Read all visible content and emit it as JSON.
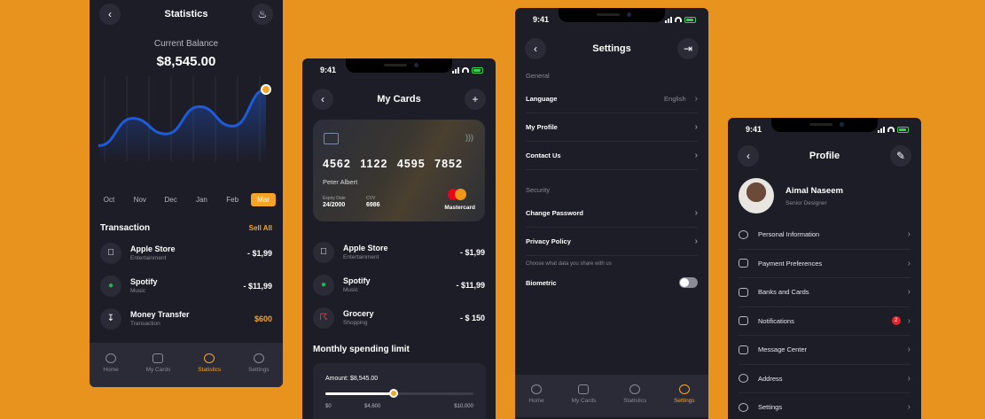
{
  "colors": {
    "background": "#E8931D",
    "panel": "#1D1D27",
    "accent": "#F7A325",
    "muted": "#8A8A97"
  },
  "statistics_screen": {
    "title": "Statistics",
    "balance_label": "Current Balance",
    "balance_value": "$8,545.00",
    "months": [
      "Oct",
      "Nov",
      "Dec",
      "Jan",
      "Feb",
      "Mar"
    ],
    "active_month": "Mar",
    "transaction_title": "Transaction",
    "see_all": "Sell All",
    "transactions": [
      {
        "icon": "apple-icon",
        "name": "Apple Store",
        "category": "Entertainment",
        "amount": "- $1,99"
      },
      {
        "icon": "spotify-icon",
        "name": "Spotify",
        "category": "Music",
        "amount": "- $11,99"
      },
      {
        "icon": "download-icon",
        "name": "Money Transfer",
        "category": "Transaction",
        "amount": "$600"
      }
    ]
  },
  "cards_screen": {
    "time": "9:41",
    "title": "My Cards",
    "card": {
      "number": "4562 1122 4595 7852",
      "holder": "Peter Albert",
      "expiry_label": "Expiry Date",
      "expiry": "24/2000",
      "cvv_label": "CVV",
      "cvv": "6986",
      "brand": "Mastercard"
    },
    "transactions": [
      {
        "icon": "apple-icon",
        "name": "Apple Store",
        "category": "Entertainment",
        "amount": "- $1,99"
      },
      {
        "icon": "spotify-icon",
        "name": "Spotify",
        "category": "Music",
        "amount": "- $11,99"
      },
      {
        "icon": "cart-icon",
        "name": "Grocery",
        "category": "Shopping",
        "amount": "- $ 150"
      }
    ],
    "limit_title": "Monthly spending limit",
    "limit_amount": "Amount: $8,545.00",
    "slider_fraction": 0.46,
    "scale": [
      "$0",
      "$4,600",
      "$10,000"
    ]
  },
  "settings_screen": {
    "time": "9:41",
    "title": "Settings",
    "general_label": "General",
    "language_label": "Language",
    "language_value": "English",
    "my_profile": "My Profile",
    "contact_us": "Contact Us",
    "security_label": "Security",
    "change_password": "Change Password",
    "privacy_policy": "Privacy Policy",
    "privacy_note": "Choose what data you share with us",
    "biometric": "Biometric"
  },
  "profile_screen": {
    "time": "9:41",
    "title": "Profile",
    "name": "Aimal Naseem",
    "role": "Senior Designer",
    "menu": [
      "Personal Information",
      "Payment Preferences",
      "Banks and Cards",
      "Notifications",
      "Message Center",
      "Address",
      "Settings"
    ],
    "notification_badge": "2"
  },
  "tabs": [
    "Home",
    "My Cards",
    "Statistics",
    "Settings"
  ],
  "chart_data": {
    "type": "area",
    "categories": [
      "Oct",
      "Nov",
      "Dec",
      "Jan",
      "Feb",
      "Mar"
    ],
    "values": [
      20,
      55,
      35,
      70,
      45,
      92
    ],
    "highlight": "Mar",
    "ylim": [
      0,
      100
    ],
    "grid": true,
    "line_color": "#1E5BD9"
  }
}
